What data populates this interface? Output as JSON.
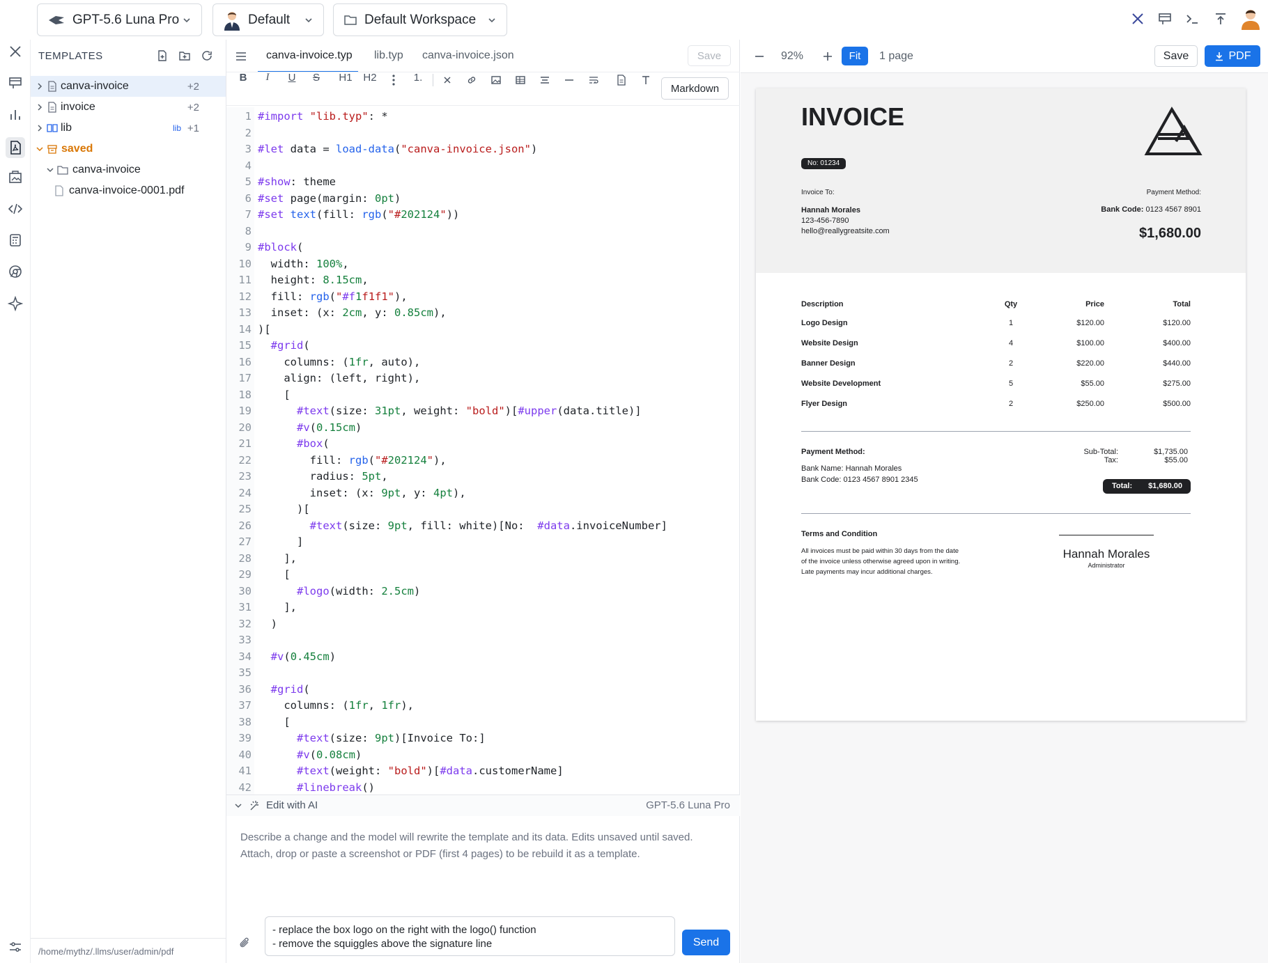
{
  "topbar": {
    "model": "GPT-5.6 Luna Pro",
    "persona": "Default",
    "workspace": "Default Workspace"
  },
  "sidebar": {
    "title": "TEMPLATES",
    "items": [
      {
        "name": "canva-invoice",
        "count": "+2"
      },
      {
        "name": "invoice",
        "count": "+2"
      },
      {
        "name": "lib",
        "badge": "lib",
        "count": "+1"
      },
      {
        "name": "saved"
      },
      {
        "name": "canva-invoice"
      },
      {
        "name": "canva-invoice-0001.pdf"
      }
    ],
    "path": "/home/mythz/.llms/user/admin/pdf"
  },
  "editor": {
    "tabs": [
      "canva-invoice.typ",
      "lib.typ",
      "canva-invoice.json"
    ],
    "save_label": "Save",
    "format_buttons": [
      "B",
      "I",
      "U",
      "S",
      "H1",
      "H2",
      "1."
    ],
    "markdown_label": "Markdown",
    "code_lines": [
      "#import \"lib.typ\": *",
      "",
      "#let data = load-data(\"canva-invoice.json\")",
      "",
      "#show: theme",
      "#set page(margin: 0pt)",
      "#set text(fill: rgb(\"#202124\"))",
      "",
      "#block(",
      "  width: 100%,",
      "  height: 8.15cm,",
      "  fill: rgb(\"#f1f1f1\"),",
      "  inset: (x: 2cm, y: 0.85cm),",
      ")[",
      "  #grid(",
      "    columns: (1fr, auto),",
      "    align: (left, right),",
      "    [",
      "      #text(size: 31pt, weight: \"bold\")[#upper(data.title)]",
      "      #v(0.15cm)",
      "      #box(",
      "        fill: rgb(\"#202124\"),",
      "        radius: 5pt,",
      "        inset: (x: 9pt, y: 4pt),",
      "      )[",
      "        #text(size: 9pt, fill: white)[No:  #data.invoiceNumber]",
      "      ]",
      "    ],",
      "    [",
      "      #logo(width: 2.5cm)",
      "    ],",
      "  )",
      "",
      "  #v(0.45cm)",
      "",
      "  #grid(",
      "    columns: (1fr, 1fr),",
      "    [",
      "      #text(size: 9pt)[Invoice To:]",
      "      #v(0.08cm)",
      "      #text(weight: \"bold\")[#data.customerName]",
      "      #linebreak()"
    ]
  },
  "ai": {
    "title": "Edit with AI",
    "model": "GPT-5.6 Luna Pro",
    "description_1": "Describe a change and the model will rewrite the template and its data. Edits unsaved until saved.",
    "description_2": "Attach, drop or paste a screenshot or PDF (first 4 pages) to be rebuild it as a template.",
    "input_line_1": "- replace the box logo on the right with the logo() function",
    "input_line_2": "- remove the squiggles above the signature line",
    "send_label": "Send"
  },
  "preview": {
    "zoom": "92%",
    "fit_label": "Fit",
    "pages": "1 page",
    "save_label": "Save",
    "pdf_label": "PDF"
  },
  "invoice": {
    "title": "INVOICE",
    "number": "No: 01234",
    "invoice_to_label": "Invoice To:",
    "customer_name": "Hannah Morales",
    "customer_phone": "123-456-7890",
    "customer_email": "hello@reallygreatsite.com",
    "payment_method_label": "Payment Method:",
    "bank_code_label": "Bank Code:",
    "bank_code_value": "0123 4567 8901",
    "total_amount": "$1,680.00",
    "columns": [
      "Description",
      "Qty",
      "Price",
      "Total"
    ],
    "rows": [
      {
        "desc": "Logo Design",
        "qty": "1",
        "price": "$120.00",
        "total": "$120.00"
      },
      {
        "desc": "Website Design",
        "qty": "4",
        "price": "$100.00",
        "total": "$400.00"
      },
      {
        "desc": "Banner Design",
        "qty": "2",
        "price": "$220.00",
        "total": "$440.00"
      },
      {
        "desc": "Website Development",
        "qty": "5",
        "price": "$55.00",
        "total": "$275.00"
      },
      {
        "desc": "Flyer Design",
        "qty": "2",
        "price": "$250.00",
        "total": "$500.00"
      }
    ],
    "payment_heading": "Payment Method:",
    "bank_name_line": "Bank Name:  Hannah Morales",
    "bank_code_line": "Bank Code:  0123 4567 8901 2345",
    "subtotal_label": "Sub-Total:",
    "subtotal_value": "$1,735.00",
    "tax_label": "Tax:",
    "tax_value": "$55.00",
    "total_label": "Total:",
    "total_value": "$1,680.00",
    "terms_heading": "Terms and Condition",
    "terms_1": "All invoices must be paid within 30 days from the date",
    "terms_2": "of the invoice unless otherwise agreed upon in writing.",
    "terms_3": "Late payments may incur additional charges.",
    "sign_name": "Hannah Morales",
    "sign_role": "Administrator"
  },
  "colors": {
    "accent": "#1a73e8",
    "dark": "#202124",
    "header_fill": "#f1f1f1",
    "saved_folder": "#d97706"
  }
}
